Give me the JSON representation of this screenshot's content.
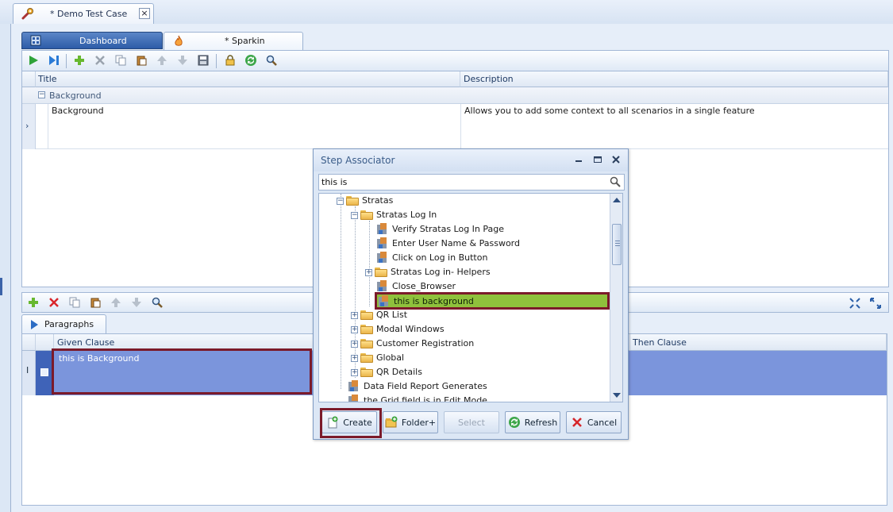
{
  "doc_tab": {
    "title": "* Demo Test Case"
  },
  "inner_tabs": [
    {
      "label": "Dashboard"
    },
    {
      "label": "* Sparkin"
    }
  ],
  "top_grid": {
    "columns": [
      "Title",
      "Description"
    ],
    "group_label": "Background",
    "rows": [
      {
        "title": "Background",
        "description": "Allows you to add some context to all scenarios in a single feature"
      }
    ]
  },
  "bottom_panel": {
    "tab_label": "Paragraphs",
    "columns": [
      "Given Clause",
      "Then Clause"
    ],
    "rows": [
      {
        "given": "this is Background",
        "then": ""
      }
    ]
  },
  "dialog": {
    "title": "Step Associator",
    "search": {
      "value": "this is",
      "placeholder": ""
    },
    "tree": [
      {
        "label": "Stratas",
        "kind": "folder"
      },
      {
        "label": "Stratas Log In",
        "kind": "folder"
      },
      {
        "label": "Verify Stratas Log In Page",
        "kind": "step"
      },
      {
        "label": "Enter User Name & Password",
        "kind": "step"
      },
      {
        "label": "Click on Log in Button",
        "kind": "step"
      },
      {
        "label": "Stratas Log in- Helpers",
        "kind": "folder"
      },
      {
        "label": "Close_Browser",
        "kind": "step"
      },
      {
        "label": "this is background",
        "kind": "step",
        "selected": true
      },
      {
        "label": "QR List",
        "kind": "folder"
      },
      {
        "label": "Modal Windows",
        "kind": "folder"
      },
      {
        "label": "Customer Registration",
        "kind": "folder"
      },
      {
        "label": "Global",
        "kind": "folder"
      },
      {
        "label": "QR Details",
        "kind": "folder"
      },
      {
        "label": "Data Field Report Generates",
        "kind": "step"
      },
      {
        "label": "the Grid field is in Edit Mode",
        "kind": "step"
      }
    ],
    "buttons": {
      "create": "Create",
      "folder": "Folder+",
      "select": "Select",
      "refresh": "Refresh",
      "cancel": "Cancel"
    }
  },
  "colors": {
    "selection_green": "#8fc13c",
    "highlight_border": "#7b1a2a",
    "row_selected": "#7b95dc"
  }
}
